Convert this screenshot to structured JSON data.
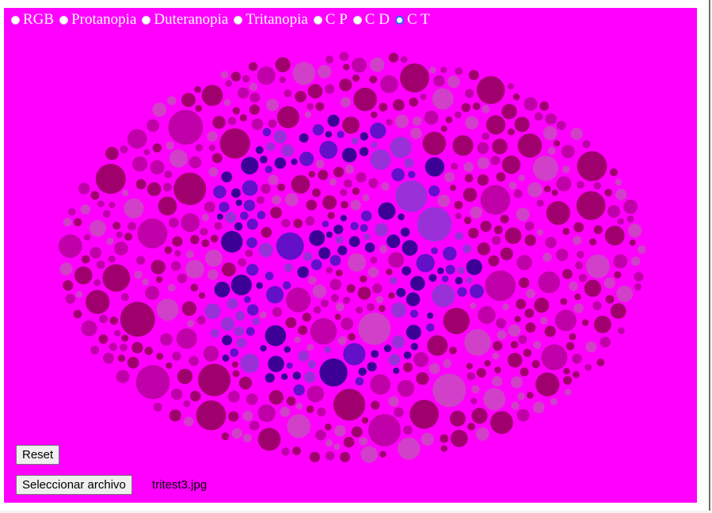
{
  "modes": {
    "options": [
      {
        "label": "RGB",
        "checked": false
      },
      {
        "label": "Protanopia",
        "checked": false
      },
      {
        "label": "Duteranopia",
        "checked": false
      },
      {
        "label": "Tritanopia",
        "checked": false
      },
      {
        "label": "C P",
        "checked": false
      },
      {
        "label": "C D",
        "checked": false
      },
      {
        "label": "C T",
        "checked": true
      }
    ]
  },
  "controls": {
    "reset_label": "Reset",
    "file_button_label": "Seleccionar archivo",
    "file_name": "tritest3.jpg"
  },
  "plate": {
    "image_name": "tritest3.jpg",
    "colors": {
      "background": "#ff00ff",
      "dot_dark": "#a0006e",
      "dot_mid": "#c000a8",
      "dot_light": "#d040c8",
      "figure_dark": "#3c0096",
      "figure_mid": "#6410c8",
      "figure_light": "#9a30d8"
    }
  }
}
